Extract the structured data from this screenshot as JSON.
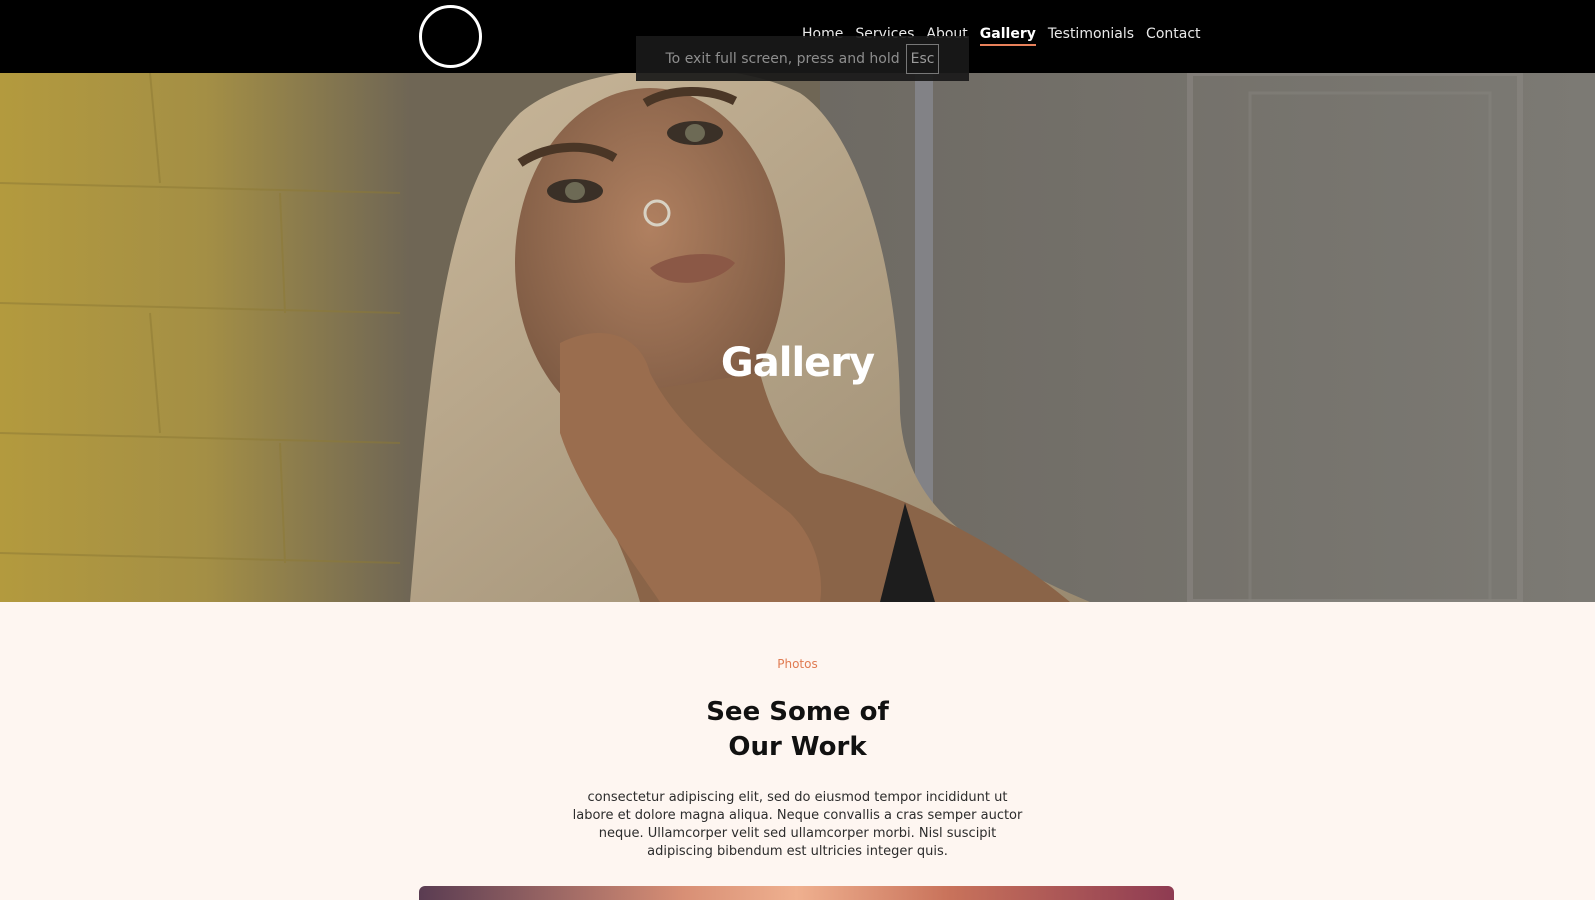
{
  "nav": {
    "items": [
      {
        "label": "Home"
      },
      {
        "label": "Services"
      },
      {
        "label": "About"
      },
      {
        "label": "Gallery",
        "active": true
      },
      {
        "label": "Testimonials"
      },
      {
        "label": "Contact"
      }
    ]
  },
  "fullscreen_toast": {
    "message": "To exit full screen, press and hold",
    "key": "Esc"
  },
  "hero": {
    "title": "Gallery"
  },
  "section": {
    "eyebrow": "Photos",
    "heading_line1": "See Some of",
    "heading_line2": "Our Work",
    "paragraph": "consectetur adipiscing elit, sed do eiusmod tempor incididunt ut labore et dolore magna aliqua. Neque convallis a cras semper auctor neque. Ullamcorper velit sed ullamcorper morbi. Nisl suscipit adipiscing bibendum est ultricies integer quis."
  },
  "colors": {
    "nav_bg": "#000000",
    "accent": "#e07b52",
    "page_bg": "#fef6f1"
  }
}
